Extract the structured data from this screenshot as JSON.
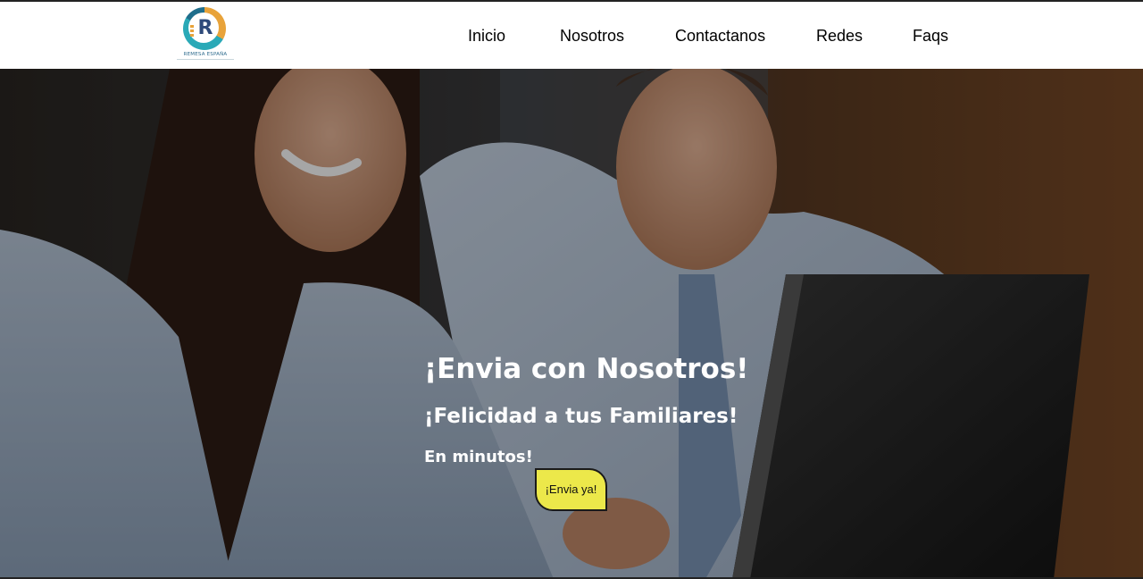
{
  "brand": {
    "logo_letter": "R",
    "logo_text": "REMESA ESPAÑA"
  },
  "nav": {
    "items": [
      {
        "label": "Inicio"
      },
      {
        "label": "Nosotros"
      },
      {
        "label": "Contactanos"
      },
      {
        "label": "Redes"
      },
      {
        "label": "Faqs"
      }
    ]
  },
  "hero": {
    "title": "¡Envia con Nosotros!",
    "subtitle": "¡Felicidad a tus Familiares!",
    "tagline": "En minutos!",
    "cta_label": "¡Envia ya!"
  },
  "colors": {
    "cta_background": "#ece84a",
    "hero_text": "#ffffff",
    "logo_teal": "#2aa9b7",
    "logo_orange": "#e8a33a",
    "logo_navy": "#2f4a7a"
  }
}
